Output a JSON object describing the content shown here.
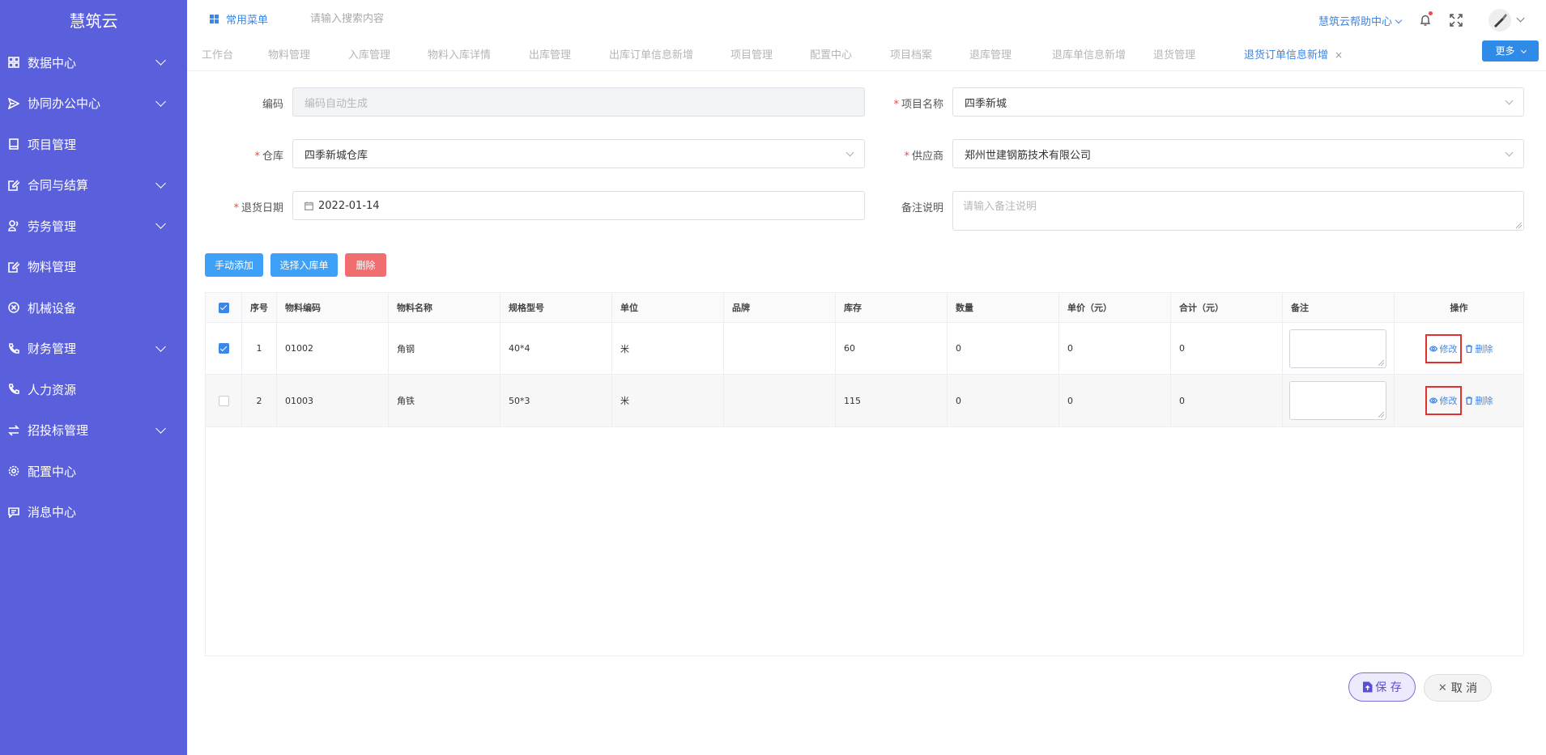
{
  "sidebar": {
    "logo": "慧筑云",
    "items": [
      {
        "label": "数据中心",
        "icon": "grid-icon",
        "expandable": true
      },
      {
        "label": "协同办公中心",
        "icon": "send-icon",
        "expandable": true
      },
      {
        "label": "项目管理",
        "icon": "book-icon",
        "expandable": false
      },
      {
        "label": "合同与结算",
        "icon": "edit-doc-icon",
        "expandable": true
      },
      {
        "label": "劳务管理",
        "icon": "user-group-icon",
        "expandable": true
      },
      {
        "label": "物料管理",
        "icon": "edit-doc-icon",
        "expandable": false
      },
      {
        "label": "机械设备",
        "icon": "close-circle-icon",
        "expandable": false
      },
      {
        "label": "财务管理",
        "icon": "phone-icon",
        "expandable": true
      },
      {
        "label": "人力资源",
        "icon": "phone-icon",
        "expandable": false
      },
      {
        "label": "招投标管理",
        "icon": "swap-icon",
        "expandable": true
      },
      {
        "label": "配置中心",
        "icon": "gear-icon",
        "expandable": false
      },
      {
        "label": "消息中心",
        "icon": "message-icon",
        "expandable": false
      }
    ]
  },
  "header": {
    "common_menu": "常用菜单",
    "search_placeholder": "请输入搜索内容",
    "help_center": "慧筑云帮助中心"
  },
  "tabs": {
    "items": [
      {
        "label": "工作台",
        "active": false
      },
      {
        "label": "物料管理",
        "active": false
      },
      {
        "label": "入库管理",
        "active": false
      },
      {
        "label": "物料入库详情",
        "active": false
      },
      {
        "label": "出库管理",
        "active": false
      },
      {
        "label": "出库订单信息新增",
        "active": false
      },
      {
        "label": "项目管理",
        "active": false
      },
      {
        "label": "配置中心",
        "active": false
      },
      {
        "label": "项目档案",
        "active": false
      },
      {
        "label": "退库管理",
        "active": false
      },
      {
        "label": "退库单信息新增",
        "active": false
      },
      {
        "label": "退货管理",
        "active": false
      },
      {
        "label": "退货订单信息新增",
        "active": true
      }
    ],
    "close_glyph": "×",
    "more_label": "更多"
  },
  "form": {
    "code_label": "编码",
    "code_placeholder": "编码自动生成",
    "project_label": "项目名称",
    "project_value": "四季新城",
    "warehouse_label": "仓库",
    "warehouse_value": "四季新城仓库",
    "supplier_label": "供应商",
    "supplier_value": "郑州世建钢筋技术有限公司",
    "date_label": "退货日期",
    "date_value": "2022-01-14",
    "remark_label": "备注说明",
    "remark_placeholder": "请输入备注说明",
    "required_mark": "*"
  },
  "actions": {
    "manual_add": "手动添加",
    "select_inbound": "选择入库单",
    "delete": "删除"
  },
  "table": {
    "headers": [
      "序号",
      "物料编码",
      "物料名称",
      "规格型号",
      "单位",
      "品牌",
      "库存",
      "数量",
      "单价（元）",
      "合计（元）",
      "备注",
      "操作"
    ],
    "rows": [
      {
        "checked": true,
        "index": "1",
        "code": "01002",
        "name": "角钢",
        "spec": "40*4",
        "unit": "米",
        "brand": "",
        "stock": "60",
        "qty": "0",
        "price": "0",
        "total": "0"
      },
      {
        "checked": false,
        "index": "2",
        "code": "01003",
        "name": "角铁",
        "spec": "50*3",
        "unit": "米",
        "brand": "",
        "stock": "115",
        "qty": "0",
        "price": "0",
        "total": "0"
      }
    ],
    "op_edit": "修改",
    "op_delete": "删除"
  },
  "footer": {
    "save": "保 存",
    "cancel": "取 消"
  },
  "colors": {
    "sidebar_bg": "#5a5fdc",
    "accent": "#3b86e6",
    "danger": "#f06e70",
    "highlight_box": "#e03131"
  }
}
